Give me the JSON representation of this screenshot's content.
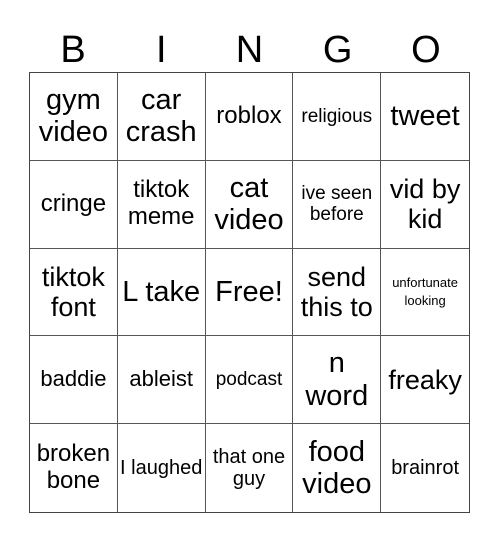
{
  "header": [
    "B",
    "I",
    "N",
    "G",
    "O"
  ],
  "cells": [
    [
      "gym video",
      "car crash",
      "roblox",
      "religious",
      "tweet"
    ],
    [
      "cringe",
      "tiktok meme",
      "cat video",
      "ive seen before",
      "vid by kid"
    ],
    [
      "tiktok font",
      "L take",
      "Free!",
      "send this to",
      "unfortunate looking"
    ],
    [
      "baddie",
      "ableist",
      "podcast",
      "n word",
      "freaky"
    ],
    [
      "broken bone",
      "I laughed",
      "that one guy",
      "food video",
      "brainrot"
    ]
  ],
  "free_space": "Free!"
}
